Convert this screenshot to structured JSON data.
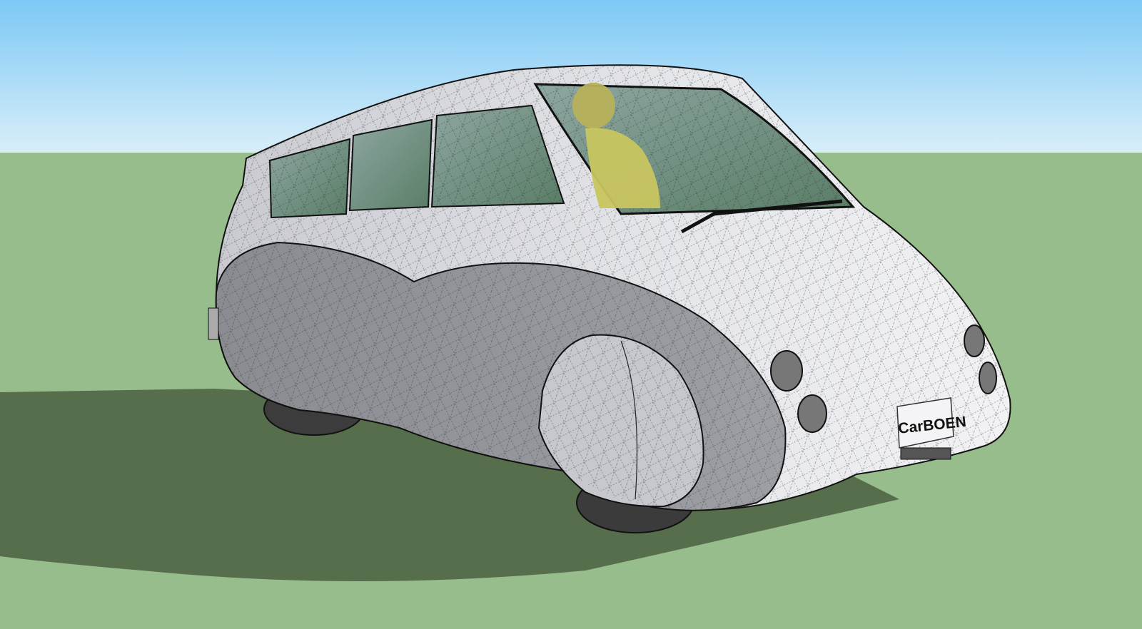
{
  "scene": {
    "sky_top_color": "#7cc8f6",
    "sky_bottom_color": "#d8eef8",
    "ground_color": "#98bd8c",
    "shadow_color": "#566e4b",
    "body_light_color": "#dcdde2",
    "body_dark_color": "#8d8f95",
    "glass_color": "#4f7a62",
    "figure_color": "#c8c560"
  },
  "plate": {
    "text": "CarBOEN",
    "icon": "license-plate"
  }
}
